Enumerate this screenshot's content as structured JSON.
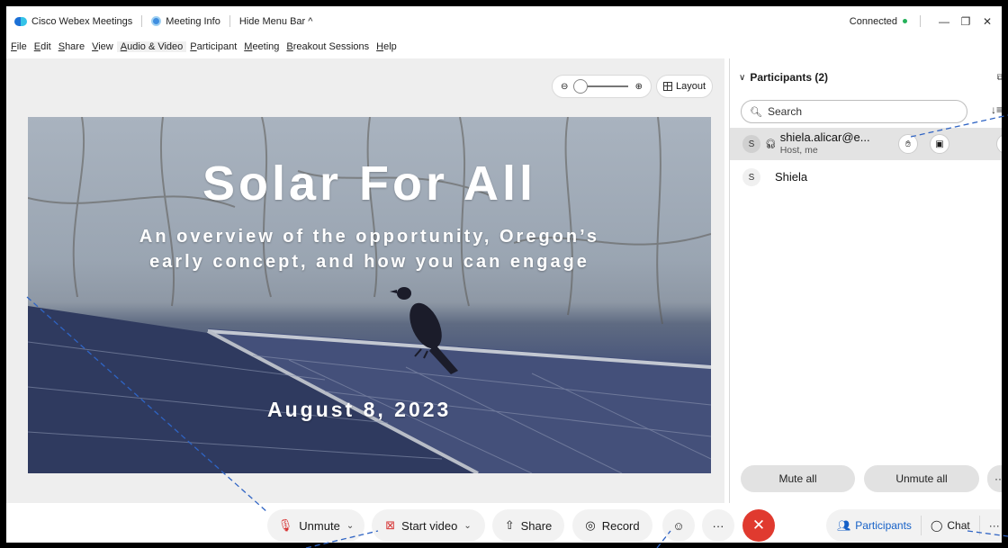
{
  "titlebar": {
    "app_name": "Cisco Webex Meetings",
    "meeting_info": "Meeting Info",
    "hide_menu": "Hide Menu Bar ^",
    "status": "Connected",
    "status_color": "#25b15a",
    "minimize": "—",
    "restore": "❐",
    "close": "✕"
  },
  "menu": [
    "File",
    "Edit",
    "Share",
    "View",
    "Audio & Video",
    "Participant",
    "Meeting",
    "Breakout Sessions",
    "Help"
  ],
  "stage": {
    "layout_label": "Layout",
    "zoom_out_icon": "⊖",
    "zoom_in_icon": "⊕"
  },
  "slide": {
    "title": "Solar For All",
    "subtitle_line1": "An overview of the opportunity, Oregon’s",
    "subtitle_line2": "early concept, and how you can engage",
    "date": "August 8, 2023"
  },
  "panel": {
    "heading": "Participants (2)",
    "search_placeholder": "Search",
    "participants": [
      {
        "initial": "S",
        "name": "shiela.alicar@e...",
        "role": "Host, me"
      },
      {
        "initial": "S",
        "name": "Shiela",
        "role": ""
      }
    ],
    "mute_all": "Mute all",
    "unmute_all": "Unmute all",
    "more": "···"
  },
  "controls": {
    "unmute": "Unmute",
    "start_video": "Start video",
    "share": "Share",
    "record": "Record",
    "more": "···",
    "leave": "✕",
    "participants": "Participants",
    "chat": "Chat",
    "right_more": "···",
    "accent_color": "#1560c7",
    "leave_color": "#e03a2f"
  }
}
